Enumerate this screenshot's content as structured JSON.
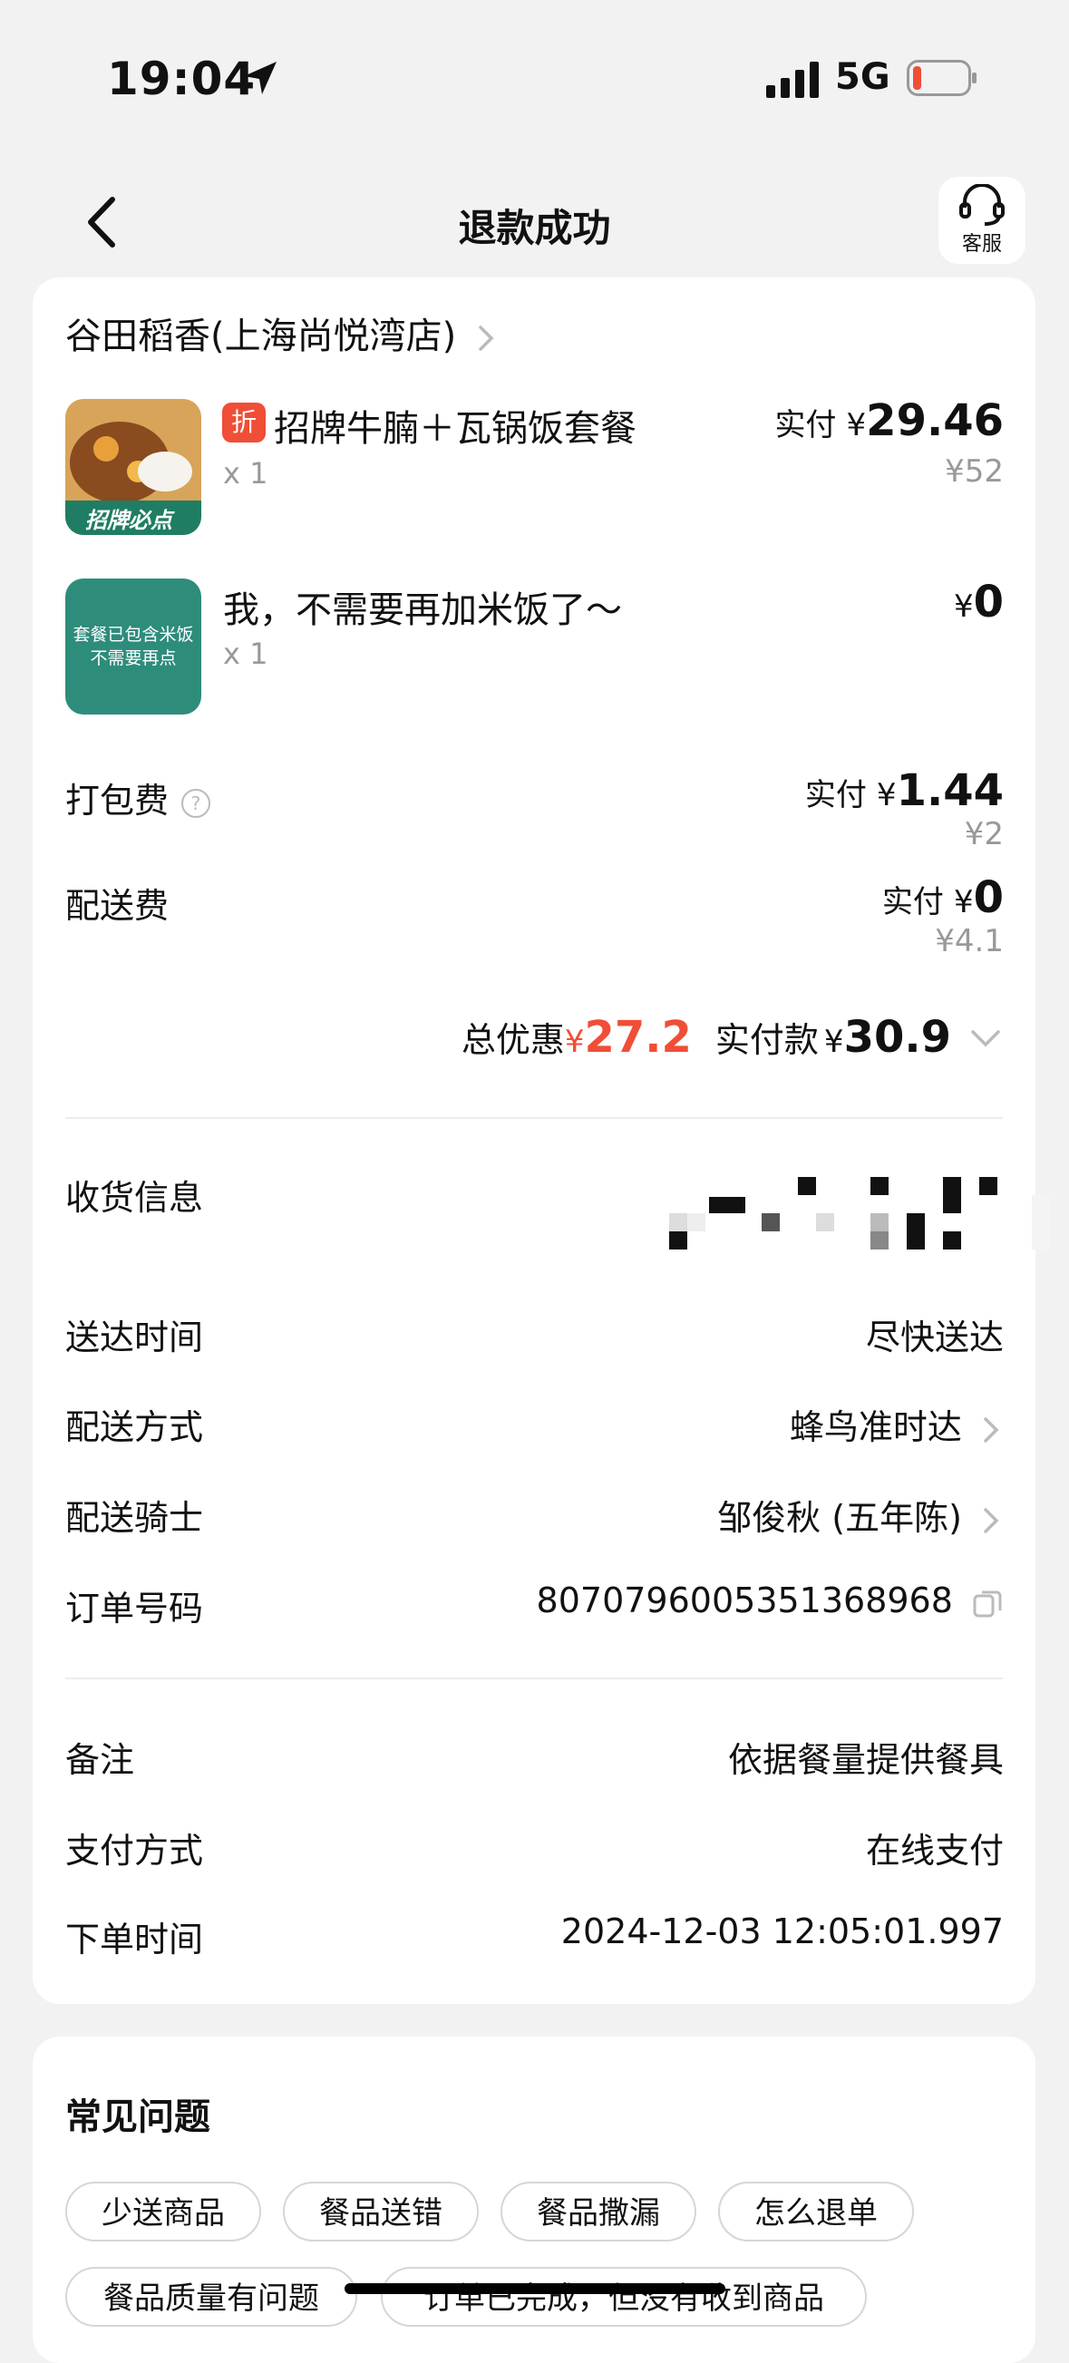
{
  "status_bar": {
    "time": "19:04",
    "network": "5G"
  },
  "nav": {
    "title": "退款成功",
    "service_label": "客服"
  },
  "store": {
    "name": "谷田稻香(上海尚悦湾店)"
  },
  "items": [
    {
      "badge": "折",
      "name": "招牌牛腩＋瓦锅饭套餐",
      "qty": "x 1",
      "paid_label": "实付",
      "currency": "¥",
      "paid": "29.46",
      "original": "¥52",
      "thumb_caption": "招牌必点"
    },
    {
      "name": "我，不需要再加米饭了～",
      "qty": "x 1",
      "currency": "¥",
      "paid": "0",
      "thumb_line1": "套餐已包含米饭",
      "thumb_line2": "不需要再点"
    }
  ],
  "fees": {
    "packing": {
      "label": "打包费",
      "info_icon": "?",
      "paid_label": "实付",
      "currency": "¥",
      "paid": "1.44",
      "original": "¥2"
    },
    "delivery": {
      "label": "配送费",
      "paid_label": "实付",
      "currency": "¥",
      "paid": "0",
      "original": "¥4.1"
    }
  },
  "totals": {
    "discount_label": "总优惠",
    "currency": "¥",
    "discount": "27.2",
    "paid_label": "实付款",
    "paid": "30.9"
  },
  "delivery_info": [
    {
      "label": "收货信息",
      "value": ""
    },
    {
      "label": "送达时间",
      "value": "尽快送达"
    },
    {
      "label": "配送方式",
      "value": "蜂鸟准时达"
    },
    {
      "label": "配送骑士",
      "value": "邹俊秋 (五年陈)"
    },
    {
      "label": "订单号码",
      "value": "8070796005351368968"
    }
  ],
  "order_info": [
    {
      "label": "备注",
      "value": "依据餐量提供餐具"
    },
    {
      "label": "支付方式",
      "value": "在线支付"
    },
    {
      "label": "下单时间",
      "value": "2024-12-03 12:05:01.997"
    }
  ],
  "faq": {
    "title": "常见问题",
    "chips": [
      "少送商品",
      "餐品送错",
      "餐品撒漏",
      "怎么退单",
      "餐品质量有问题",
      "订单已完成，但没有收到商品"
    ]
  },
  "colors": {
    "accent_red": "#f04e37",
    "thumb_green": "#2e8c7b"
  }
}
